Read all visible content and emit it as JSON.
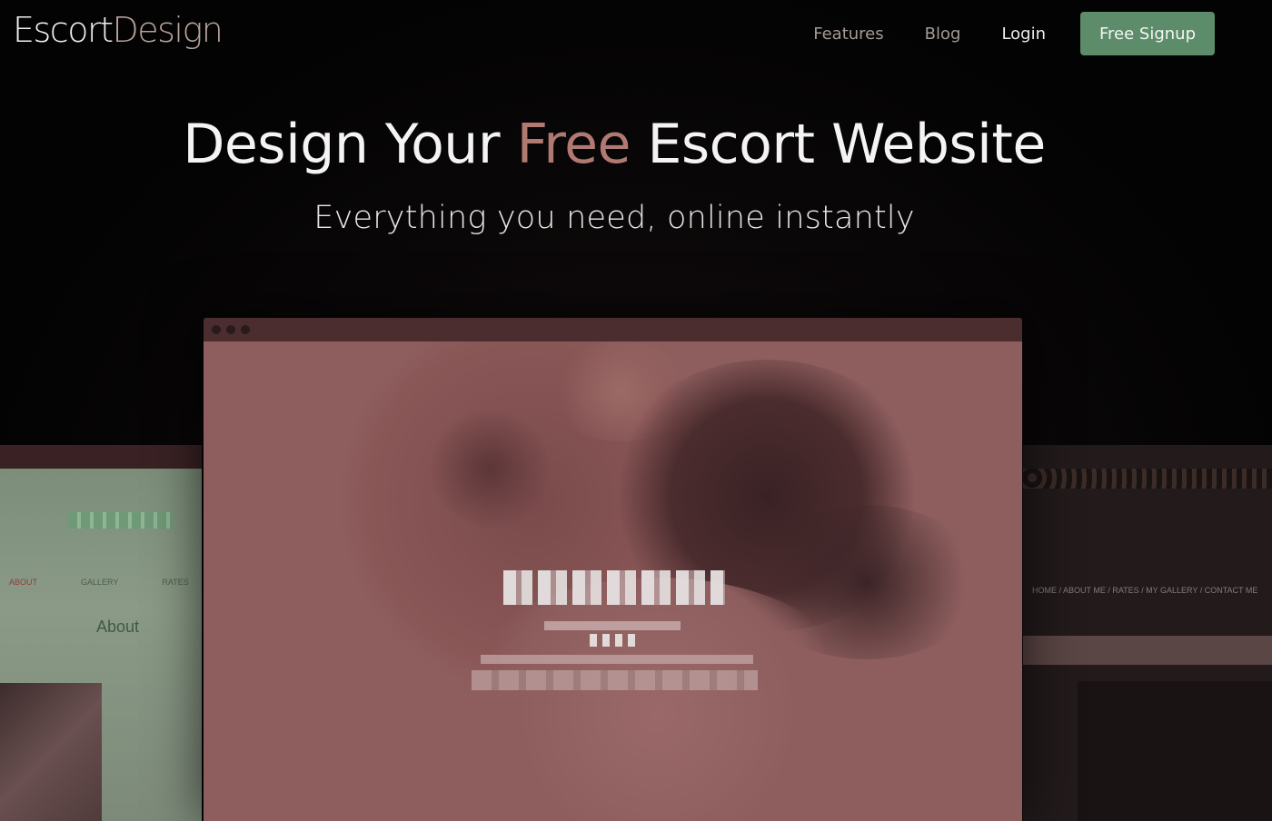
{
  "brand": {
    "logo_part1": "Escort",
    "logo_part2": "Design"
  },
  "nav": {
    "items": [
      {
        "label": "Features"
      },
      {
        "label": "Blog"
      },
      {
        "label": "Login"
      }
    ],
    "signup_label": "Free Signup"
  },
  "hero": {
    "headline_before": "Design Your ",
    "headline_accent": "Free",
    "headline_after": " Escort Website",
    "subheadline": "Everything you need, online instantly"
  },
  "preview_left": {
    "nav_items": [
      "ABOUT",
      "GALLERY",
      "RATES"
    ],
    "section_title": "About"
  },
  "preview_right": {
    "nav_text": "HOME / ABOUT ME / RATES / MY GALLERY / CONTACT ME"
  },
  "colors": {
    "accent": "#b07a72",
    "signup_button": "#5c8c6a",
    "background": "#040404",
    "mockup_tint": "#8e5e5e"
  }
}
